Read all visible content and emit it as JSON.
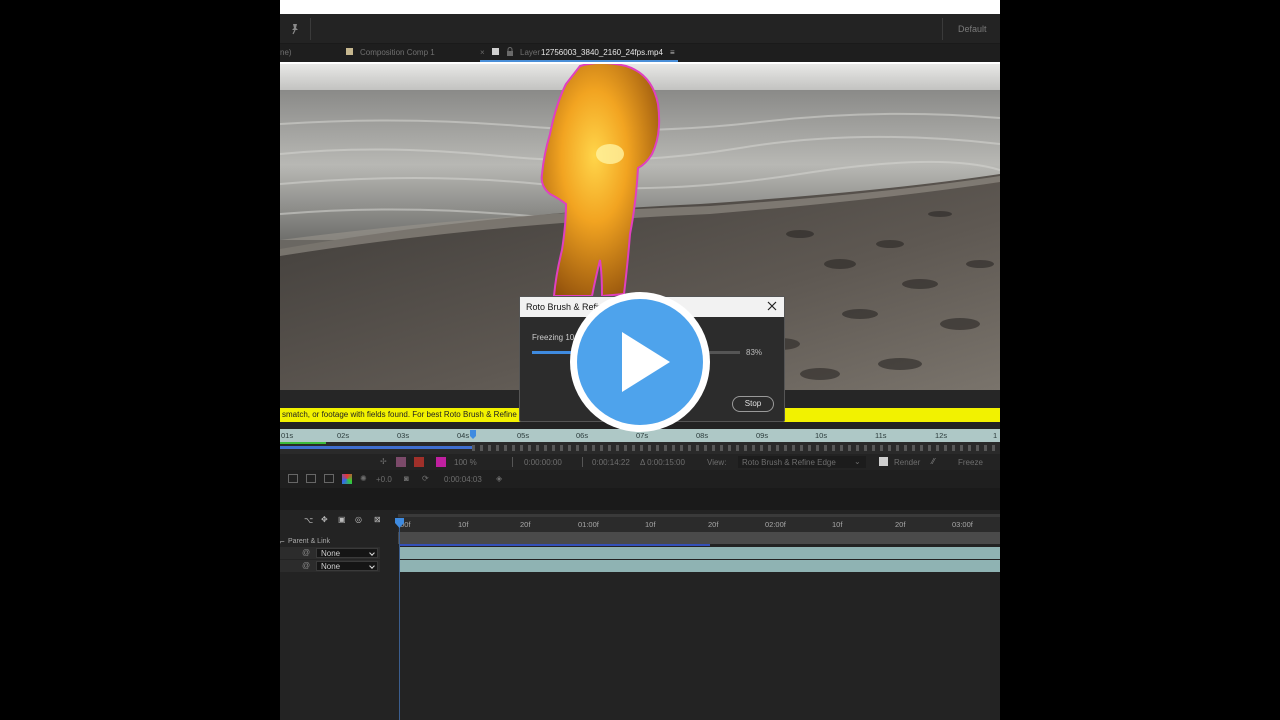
{
  "toolbar": {
    "workspace": "Default"
  },
  "tabs": [
    {
      "label": "ne)"
    },
    {
      "label": "Composition Comp 1"
    },
    {
      "label": "Layer"
    },
    {
      "label": "12756003_3840_2160_24fps.mp4"
    }
  ],
  "warning": {
    "message": "smatch, or footage with fields found. For best Roto Brush & Refine Edge r"
  },
  "layer_ruler": {
    "ticks": [
      "01s",
      "02s",
      "03s",
      "04s",
      "05s",
      "06s",
      "07s",
      "08s",
      "09s",
      "10s",
      "11s",
      "12s",
      "1"
    ]
  },
  "roto_controls": {
    "zoom": "100 %",
    "time_start": "0:00:00:00",
    "time_current": "0:00:14:22",
    "time_duration": "Δ 0:00:15:00",
    "view_label": "View:",
    "view_value": "Roto Brush & Refine Edge",
    "render_label": "Render",
    "freeze_label": "Freeze"
  },
  "viewer_footer": {
    "exposure": "+0.0",
    "timecode": "0:00:04:03"
  },
  "timeline": {
    "ticks": [
      ":00f",
      "10f",
      "20f",
      "01:00f",
      "10f",
      "20f",
      "02:00f",
      "10f",
      "20f",
      "03:00f"
    ],
    "parent_header": "Parent & Link",
    "rows": [
      {
        "parent": "None"
      },
      {
        "parent": "None"
      }
    ]
  },
  "dialog": {
    "title": "Roto Brush & Refine Edge",
    "status": "Freezing 10",
    "progress": 0.83,
    "percent_label": "83%",
    "stop_label": "Stop"
  },
  "colors": {
    "accent": "#3f8be0",
    "warning": "#f2f200",
    "matte_orange": "#f0a020",
    "matte_outline": "#e040c0",
    "play_button": "#4ea3ec"
  }
}
